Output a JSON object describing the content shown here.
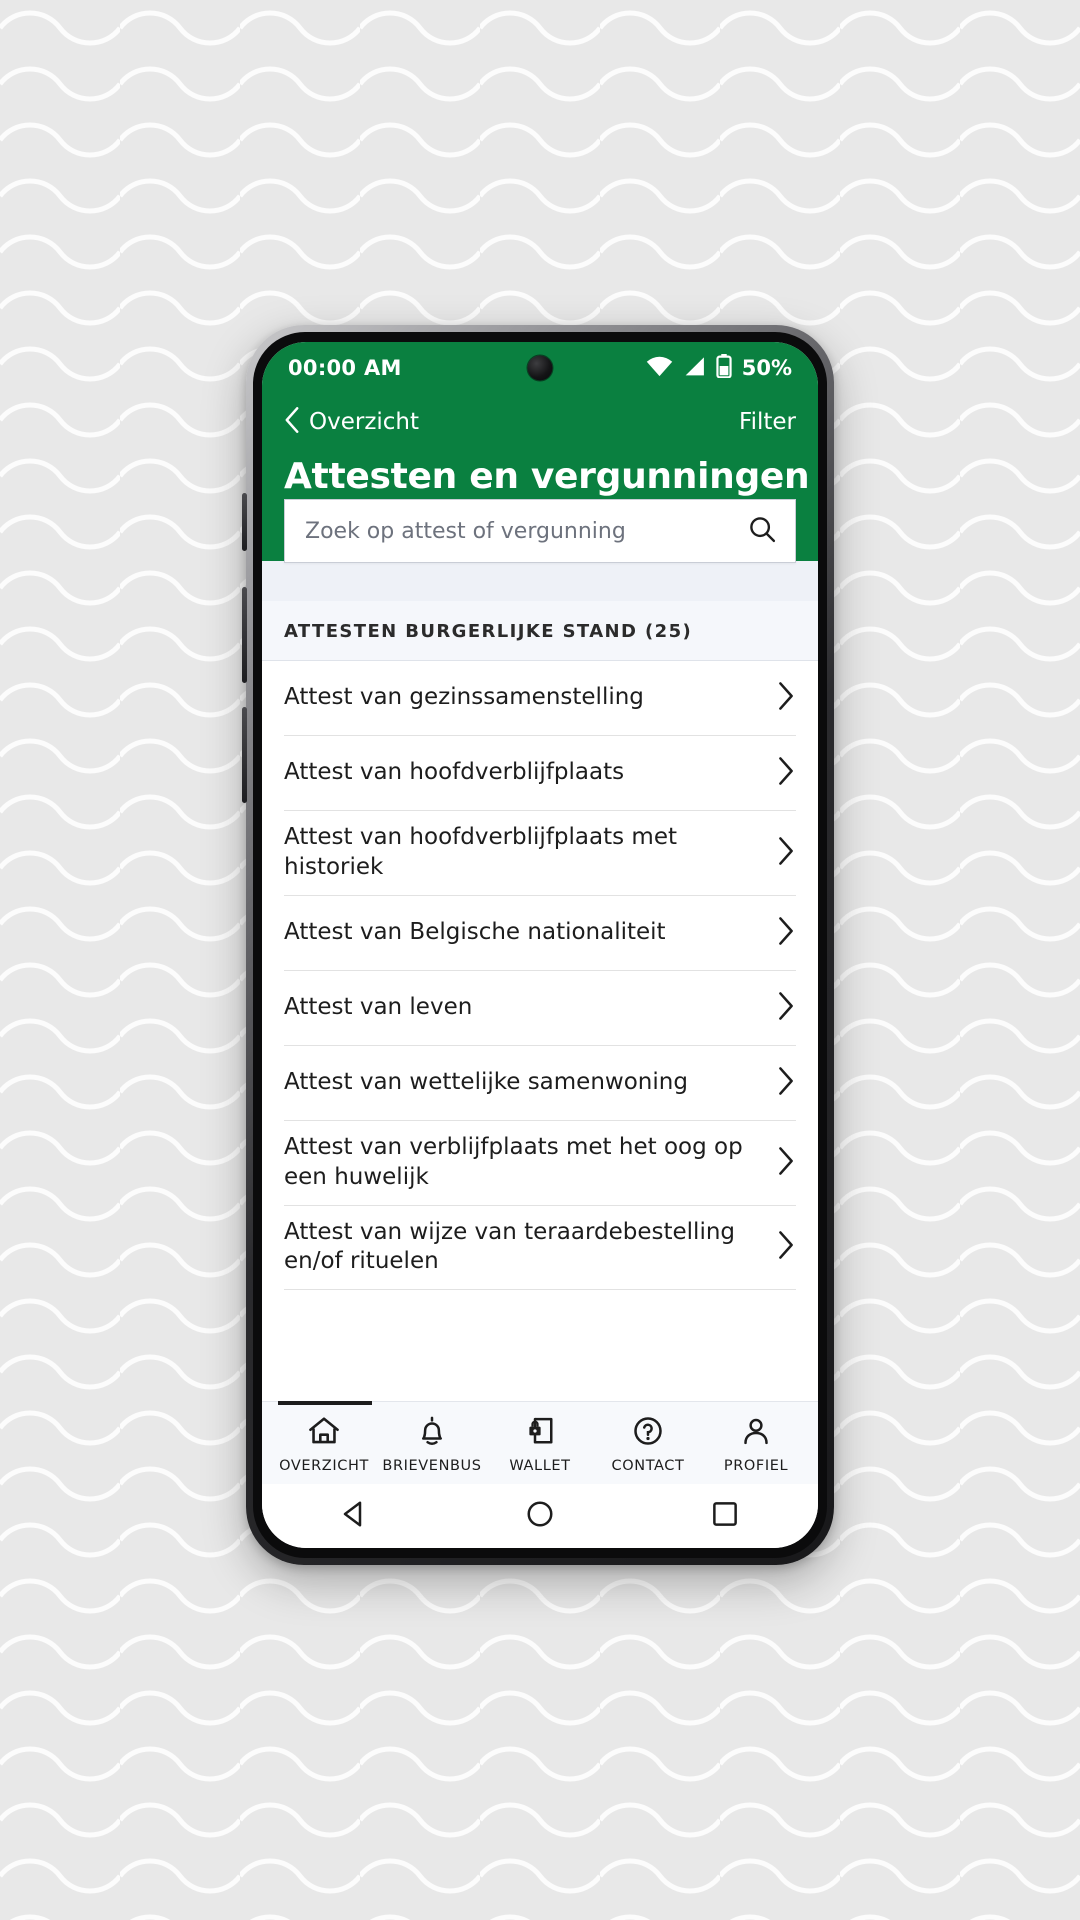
{
  "statusbar": {
    "time": "00:00 AM",
    "battery_text": "50%",
    "wifi_icon": "wifi-icon",
    "signal_icon": "signal-icon",
    "battery_icon": "battery-icon",
    "camera_icon": "front-camera-dot"
  },
  "header": {
    "back_label": "Overzicht",
    "back_icon": "chevron-left-icon",
    "filter_label": "Filter",
    "title": "Attesten en vergunningen",
    "background_color": "#0a8040"
  },
  "search": {
    "placeholder": "Zoek op attest of vergunning",
    "value": "",
    "icon": "search-icon"
  },
  "section": {
    "title": "ATTESTEN BURGERLIJKE STAND (25)",
    "count": 25
  },
  "list": {
    "chevron_icon": "chevron-right-icon",
    "items": [
      {
        "label": "Attest van gezinssamenstelling"
      },
      {
        "label": "Attest van hoofdverblijfplaats"
      },
      {
        "label": "Attest van hoofdverblijfplaats met historiek"
      },
      {
        "label": "Attest van Belgische nationaliteit"
      },
      {
        "label": "Attest van leven"
      },
      {
        "label": "Attest van wettelijke samenwoning"
      },
      {
        "label": "Attest van verblijfplaats met het oog op een huwelijk"
      },
      {
        "label": "Attest van wijze van teraardebestelling en/of rituelen"
      }
    ]
  },
  "bottom_nav": {
    "items": [
      {
        "label": "OVERZICHT",
        "icon": "home-icon"
      },
      {
        "label": "BRIEVENBUS",
        "icon": "bell-icon"
      },
      {
        "label": "WALLET",
        "icon": "wallet-lock-card-icon"
      },
      {
        "label": "CONTACT",
        "icon": "question-circle-icon"
      },
      {
        "label": "PROFIEL",
        "icon": "person-icon"
      }
    ]
  },
  "system_bar": {
    "back_icon": "android-back-triangle-icon",
    "home_icon": "android-home-circle-icon",
    "recents_icon": "android-recents-square-icon"
  }
}
